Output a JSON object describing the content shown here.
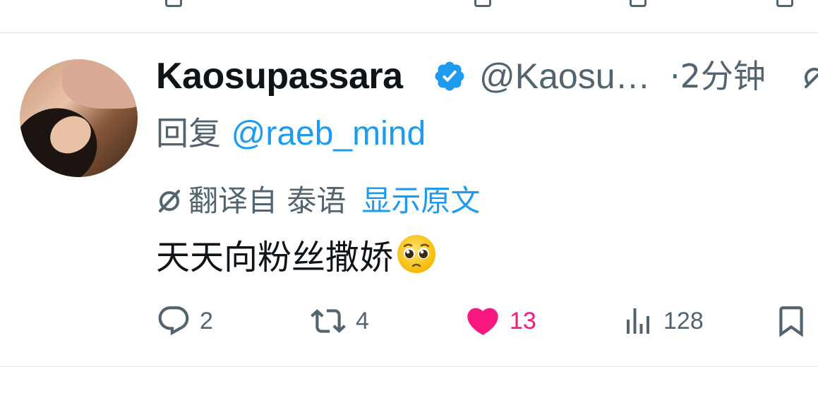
{
  "tweet": {
    "display_name": "Kaosupassara",
    "handle": "@Kaosu…",
    "time": "·2分钟",
    "reply_prefix": "回复",
    "reply_target": "@raeb_mind",
    "translated_label": "翻译自 泰语",
    "show_original": "显示原文",
    "text": "天天向粉丝撒娇",
    "emoji": "pleading-face-emoji"
  },
  "actions": {
    "reply_count": "2",
    "retweet_count": "4",
    "like_count": "13",
    "views_count": "128"
  },
  "icons": {
    "verified": "verified-badge-icon",
    "grok": "grok-icon",
    "translate": "translate-icon",
    "reply": "reply-icon",
    "retweet": "retweet-icon",
    "like": "heart-icon",
    "views": "views-icon",
    "bookmark": "bookmark-icon"
  },
  "colors": {
    "accent": "#1d9bf0",
    "like": "#f91880",
    "muted": "#536471",
    "text": "#0f1419"
  }
}
